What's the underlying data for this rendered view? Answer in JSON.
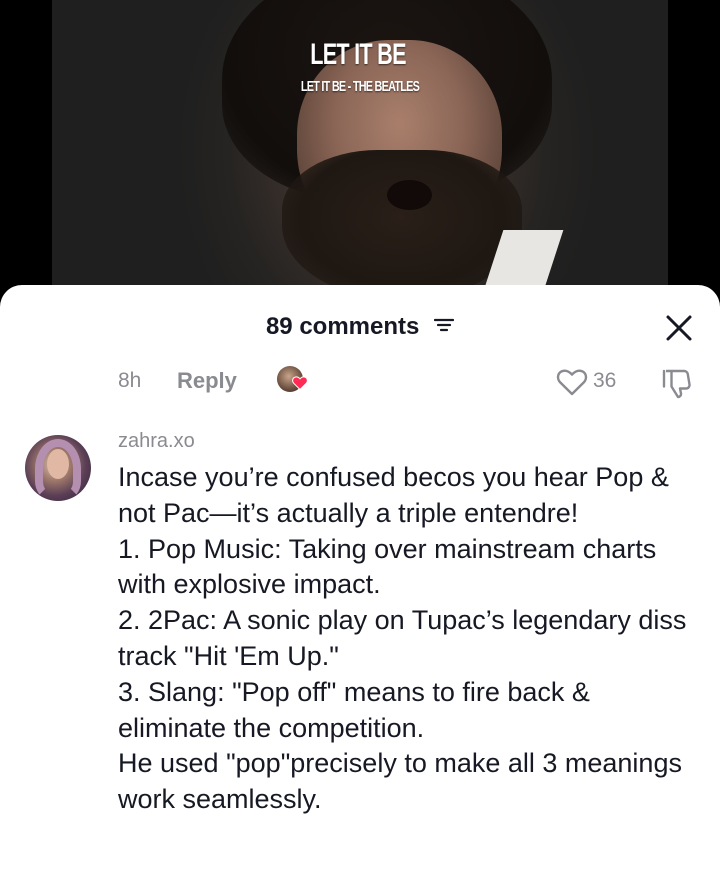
{
  "video": {
    "title": "LET IT BE",
    "subtitle": "LET IT BE - THE BEATLES"
  },
  "comments_panel": {
    "count_label": "89 comments",
    "sort_icon": "sort-lines-icon",
    "close_icon": "close-x-icon"
  },
  "previous_comment": {
    "time": "8h",
    "reply_label": "Reply",
    "like_count": "36",
    "colors": {
      "heart_badge": "#fe2c55",
      "meta_text": "#8a8b91"
    }
  },
  "comment": {
    "username": "zahra.xo",
    "text": "Incase you’re confused becos you hear Pop & not Pac—it’s actually a triple entendre!\n1. Pop Music: Taking over mainstream charts with explosive impact.\n2. 2Pac: A sonic play on Tupac’s legendary diss track \"Hit 'Em Up.\"\n3. Slang: \"Pop off\" means to fire back & eliminate the competition.\nHe used \"pop\"precisely to make all 3 meanings work seamlessly."
  }
}
